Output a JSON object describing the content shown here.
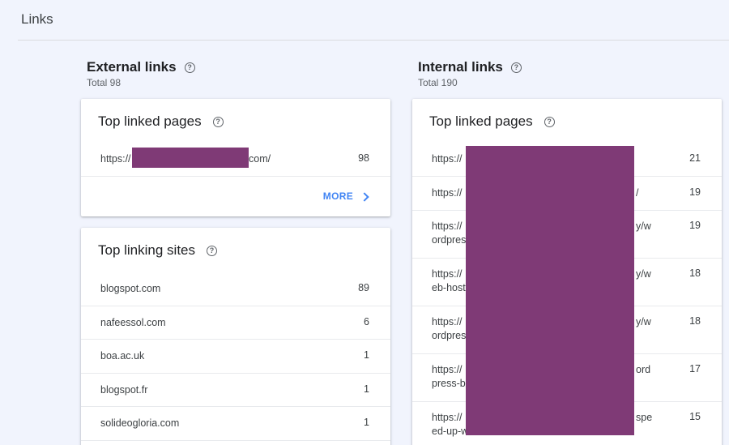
{
  "header": {
    "title": "Links"
  },
  "external": {
    "title": "External links",
    "total": "Total 98",
    "top_linked_pages": {
      "title": "Top linked pages",
      "rows": [
        {
          "url_start": "https://",
          "url_end": "com/",
          "count": "98"
        }
      ],
      "more_label": "MORE"
    },
    "top_linking_sites": {
      "title": "Top linking sites",
      "rows": [
        {
          "site": "blogspot.com",
          "count": "89"
        },
        {
          "site": "nafeessol.com",
          "count": "6"
        },
        {
          "site": "boa.ac.uk",
          "count": "1"
        },
        {
          "site": "blogspot.fr",
          "count": "1"
        },
        {
          "site": "solideogloria.com",
          "count": "1"
        }
      ]
    }
  },
  "internal": {
    "title": "Internal links",
    "total": "Total 190",
    "top_linked_pages": {
      "title": "Top linked pages",
      "rows": [
        {
          "line1": "https://",
          "tail1": "",
          "line2": "",
          "count": "21"
        },
        {
          "line1": "https://",
          "tail1": "/",
          "line2": "",
          "count": "19"
        },
        {
          "line1": "https://",
          "tail1": "y/w",
          "line2": "ordpres",
          "count": "19"
        },
        {
          "line1": "https://",
          "tail1": "y/w",
          "line2": "eb-host",
          "count": "18"
        },
        {
          "line1": "https://",
          "tail1": "y/w",
          "line2": "ordpres",
          "count": "18"
        },
        {
          "line1": "https://",
          "tail1": "ord",
          "line2": "press-bl",
          "count": "17"
        },
        {
          "line1": "https://",
          "tail1": "spe",
          "line2": "ed-up-w",
          "count": "15"
        }
      ]
    }
  },
  "colors": {
    "redaction": "#7f3a76",
    "accent": "#4285f4",
    "background": "#f1f4fd"
  },
  "icons": {
    "help": "help-circle-icon",
    "more": "chevron-right-icon"
  }
}
